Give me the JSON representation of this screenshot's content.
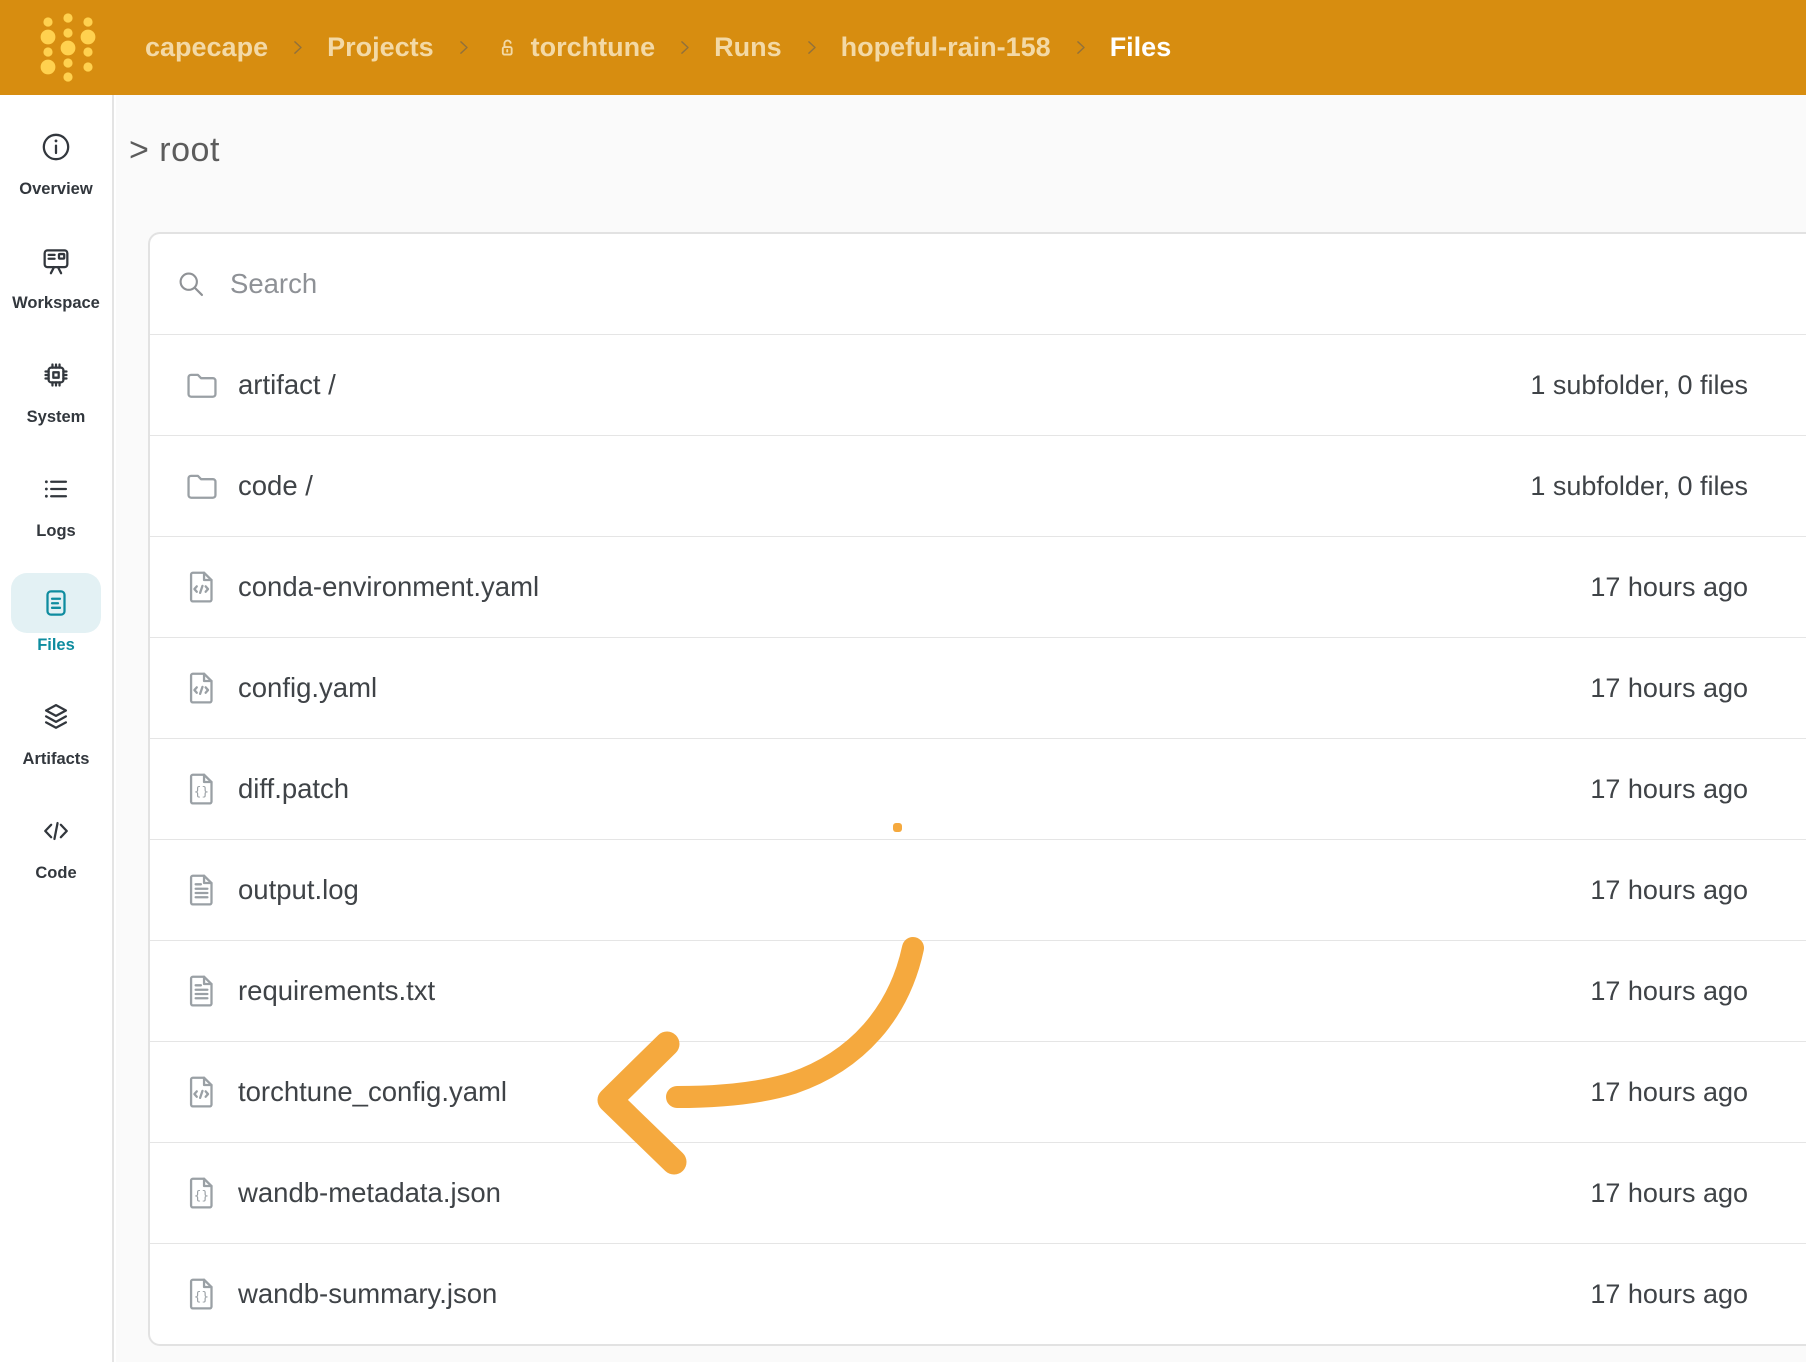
{
  "theme": {
    "header_bg": "#D78D10",
    "logo_gold": "#FFD14F",
    "accent_teal": "#0E8C9F",
    "arrow_orange": "#F5A93E"
  },
  "header": {
    "breadcrumb": [
      {
        "label": "capecape"
      },
      {
        "label": "Projects"
      },
      {
        "label": "torchtune",
        "lock": true
      },
      {
        "label": "Runs"
      },
      {
        "label": "hopeful-rain-158"
      },
      {
        "label": "Files",
        "current": true
      }
    ]
  },
  "sidebar": {
    "items": [
      {
        "label": "Overview",
        "icon": "info-circle"
      },
      {
        "label": "Workspace",
        "icon": "easel-board"
      },
      {
        "label": "System",
        "icon": "cpu-chip"
      },
      {
        "label": "Logs",
        "icon": "list"
      },
      {
        "label": "Files",
        "icon": "document",
        "active": true
      },
      {
        "label": "Artifacts",
        "icon": "layers"
      },
      {
        "label": "Code",
        "icon": "code-brackets"
      }
    ]
  },
  "main": {
    "root_heading": "> root",
    "search": {
      "placeholder": "Search"
    },
    "files": [
      {
        "name": "artifact /",
        "icon": "folder",
        "meta": "1 subfolder, 0 files"
      },
      {
        "name": "code /",
        "icon": "folder",
        "meta": "1 subfolder, 0 files"
      },
      {
        "name": "conda-environment.yaml",
        "icon": "file-code",
        "meta": "17 hours ago"
      },
      {
        "name": "config.yaml",
        "icon": "file-code",
        "meta": "17 hours ago"
      },
      {
        "name": "diff.patch",
        "icon": "file-braces",
        "meta": "17 hours ago"
      },
      {
        "name": "output.log",
        "icon": "file-text",
        "meta": "17 hours ago"
      },
      {
        "name": "requirements.txt",
        "icon": "file-text",
        "meta": "17 hours ago"
      },
      {
        "name": "torchtune_config.yaml",
        "icon": "file-code",
        "meta": "17 hours ago"
      },
      {
        "name": "wandb-metadata.json",
        "icon": "file-braces",
        "meta": "17 hours ago"
      },
      {
        "name": "wandb-summary.json",
        "icon": "file-braces",
        "meta": "17 hours ago"
      }
    ]
  }
}
